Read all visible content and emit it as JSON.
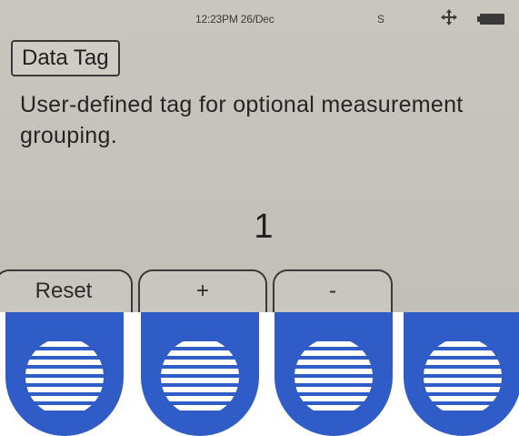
{
  "status_bar": {
    "time": "12:23PM 26/Dec",
    "indicator": "S",
    "icons": [
      "move-arrows-icon",
      "battery-icon"
    ]
  },
  "title": "Data Tag",
  "description": "User-defined tag for optional measurement grouping.",
  "value": "1",
  "softkeys": [
    {
      "label": "Reset"
    },
    {
      "label": "+"
    },
    {
      "label": "-"
    },
    {
      "label": ""
    }
  ],
  "colors": {
    "screen_bg": "#c6c3bc",
    "text": "#222222",
    "button_blue": "#2f5cc6",
    "button_stripes": "#ffffff"
  }
}
